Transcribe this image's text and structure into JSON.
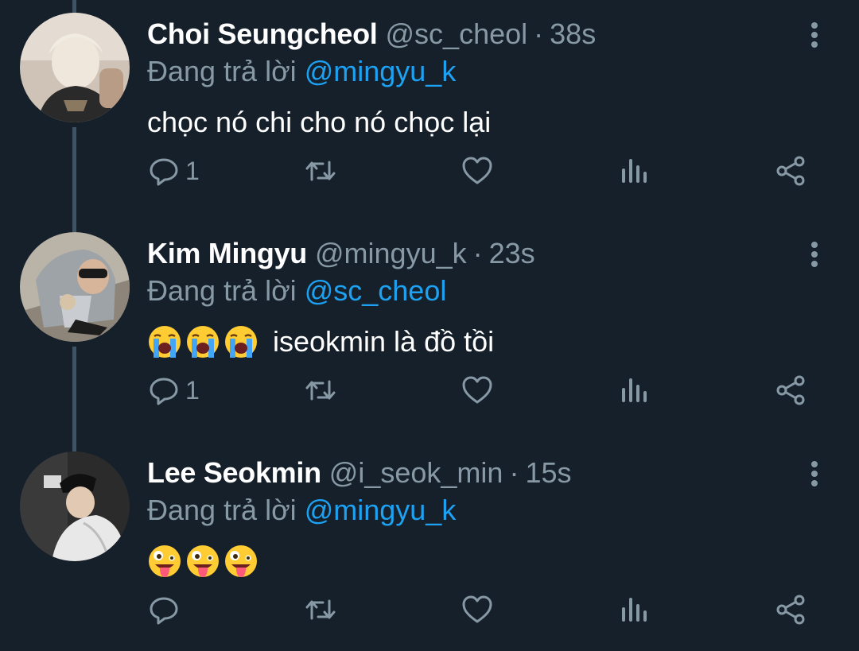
{
  "tweets": [
    {
      "name": "Choi Seungcheol",
      "handle": "@sc_cheol",
      "separator": "·",
      "time": "38s",
      "reply_prefix": "Đang trả lời",
      "reply_to": "@mingyu_k",
      "text": "chọc nó chi cho nó chọc lại",
      "emojis": [],
      "reply_count": "1"
    },
    {
      "name": "Kim Mingyu",
      "handle": "@mingyu_k",
      "separator": "·",
      "time": "23s",
      "reply_prefix": "Đang trả lời",
      "reply_to": "@sc_cheol",
      "text": "iseokmin là đồ tồi",
      "emojis": [
        "loudly-crying-face",
        "loudly-crying-face",
        "loudly-crying-face"
      ],
      "reply_count": "1"
    },
    {
      "name": "Lee Seokmin",
      "handle": "@i_seok_min",
      "separator": "·",
      "time": "15s",
      "reply_prefix": "Đang trả lời",
      "reply_to": "@mingyu_k",
      "text": "",
      "emojis": [
        "zany-face",
        "zany-face",
        "zany-face"
      ],
      "reply_count": ""
    }
  ],
  "icons": [
    "reply-icon",
    "retweet-icon",
    "like-icon",
    "analytics-icon",
    "share-icon",
    "more-icon"
  ],
  "colors": {
    "background": "#15202b",
    "secondary_text": "#8899a6",
    "link": "#1da1f2",
    "thread_line": "#3d5466"
  }
}
